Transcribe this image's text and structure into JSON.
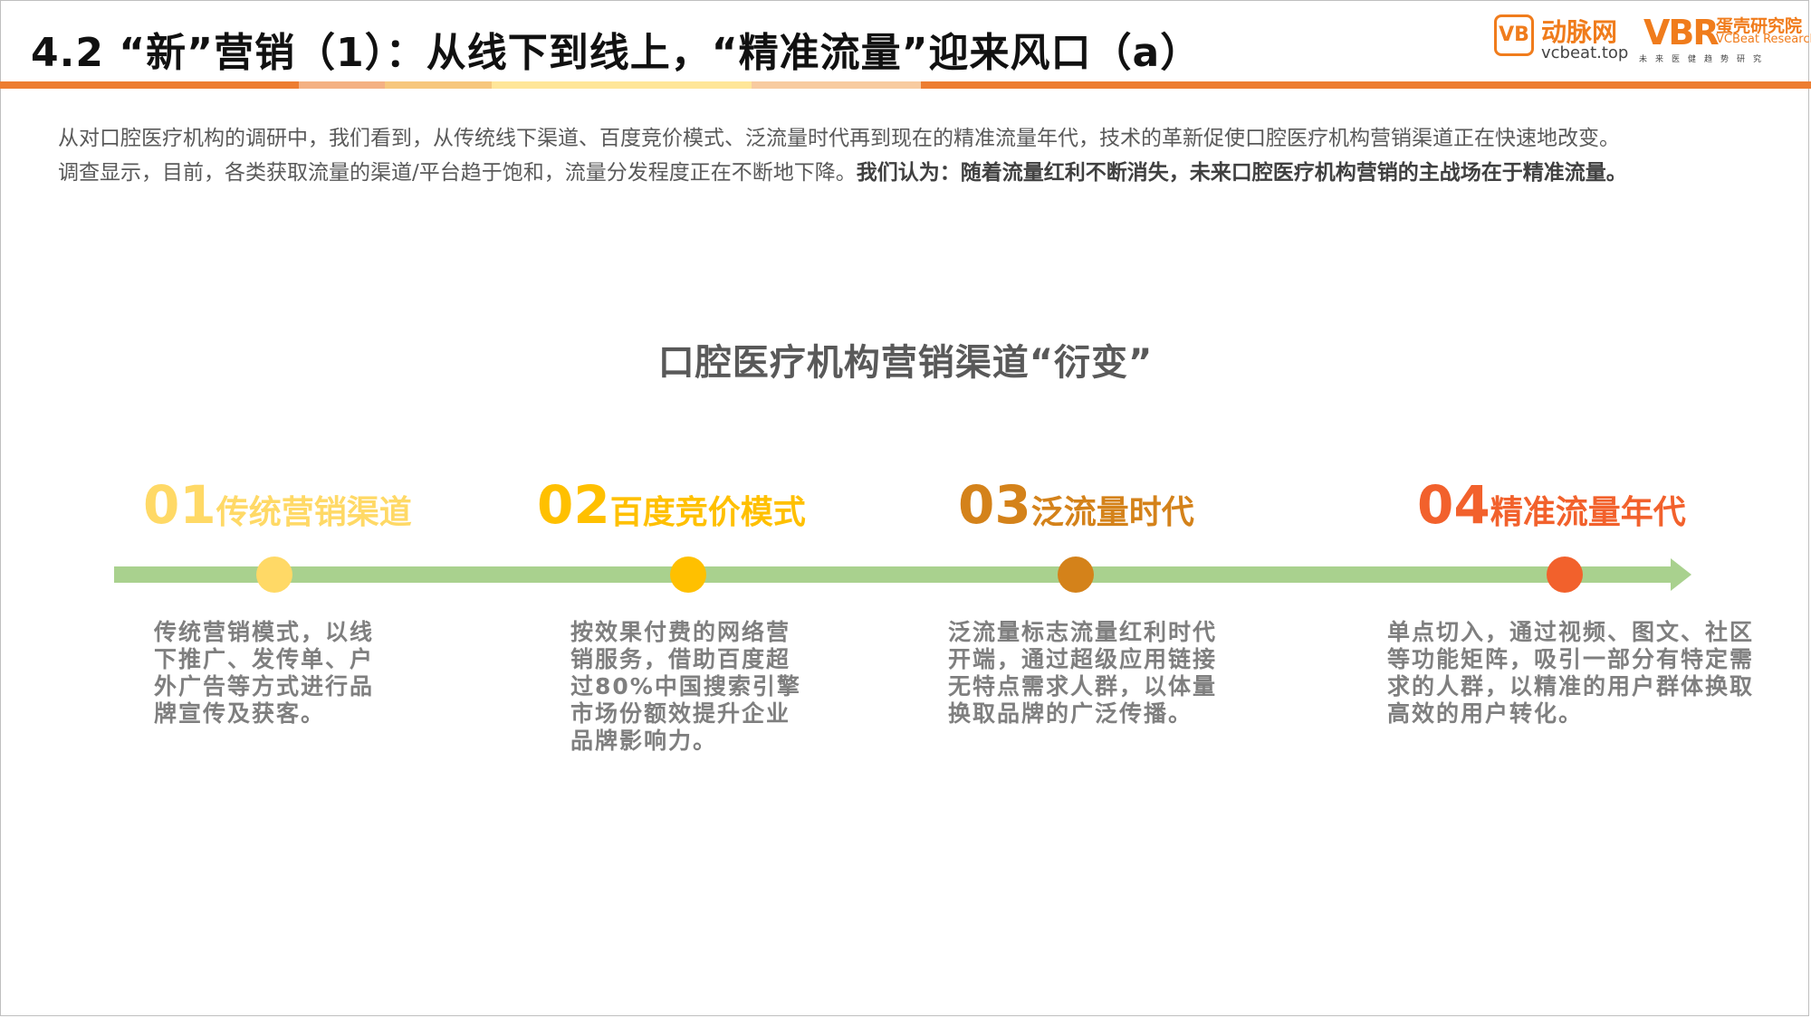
{
  "header": {
    "title": "4.2 “新”营销（1）：从线下到线上，“精准流量”迎来风口（a）"
  },
  "logos": {
    "vcbeat_badge": "VB",
    "vcbeat_name": "动脉网",
    "vcbeat_url": "vcbeat.top",
    "vbr_mark": "VBR",
    "vbr_cn": "蛋壳研究院",
    "vbr_en": "VCBeat Research",
    "vbr_sub": "未来医健趋势研究"
  },
  "intro": {
    "line1": "从对口腔医疗机构的调研中，我们看到，从传统线下渠道、百度竞价模式、泛流量时代再到现在的精准流量年代，技术的革新促使口腔医疗机构营销渠道正在快速地改变。",
    "line2_normal": "调查显示，目前，各类获取流量的渠道/平台趋于饱和，流量分发程度正在不断地下降。",
    "line2_bold": "我们认为：随着流量红利不断消失，未来口腔医疗机构营销的主战场在于精准流量。"
  },
  "diagram": {
    "title": "口腔医疗机构营销渠道“衍变”",
    "stages": [
      {
        "num": "01",
        "name": "传统营销渠道",
        "color": "#ffd966",
        "desc": [
          "传统营销模式，以线",
          "下推广、发传单、户",
          "外广告等方式进行品",
          "牌宣传及获客。"
        ]
      },
      {
        "num": "02",
        "name": "百度竞价模式",
        "color": "#ffc000",
        "desc": [
          "按效果付费的网络营",
          "销服务，借助百度超",
          "过80%中国搜索引擎",
          "市场份额效提升企业",
          "品牌影响力。"
        ]
      },
      {
        "num": "03",
        "name": "泛流量时代",
        "color": "#d4821a",
        "desc": [
          "泛流量标志流量红利时代",
          "开端，通过超级应用链接",
          "无特点需求人群，以体量",
          "换取品牌的广泛传播。"
        ]
      },
      {
        "num": "04",
        "name": "精准流量年代",
        "color": "#f2612c",
        "desc": [
          "单点切入，通过视频、图文、社区",
          "等功能矩阵，吸引一部分有特定需",
          "求的人群，以精准的用户群体换取",
          "高效的用户转化。"
        ]
      }
    ]
  },
  "colors": {
    "timeline": "#a9d18e",
    "accent": "#ed7d31"
  }
}
